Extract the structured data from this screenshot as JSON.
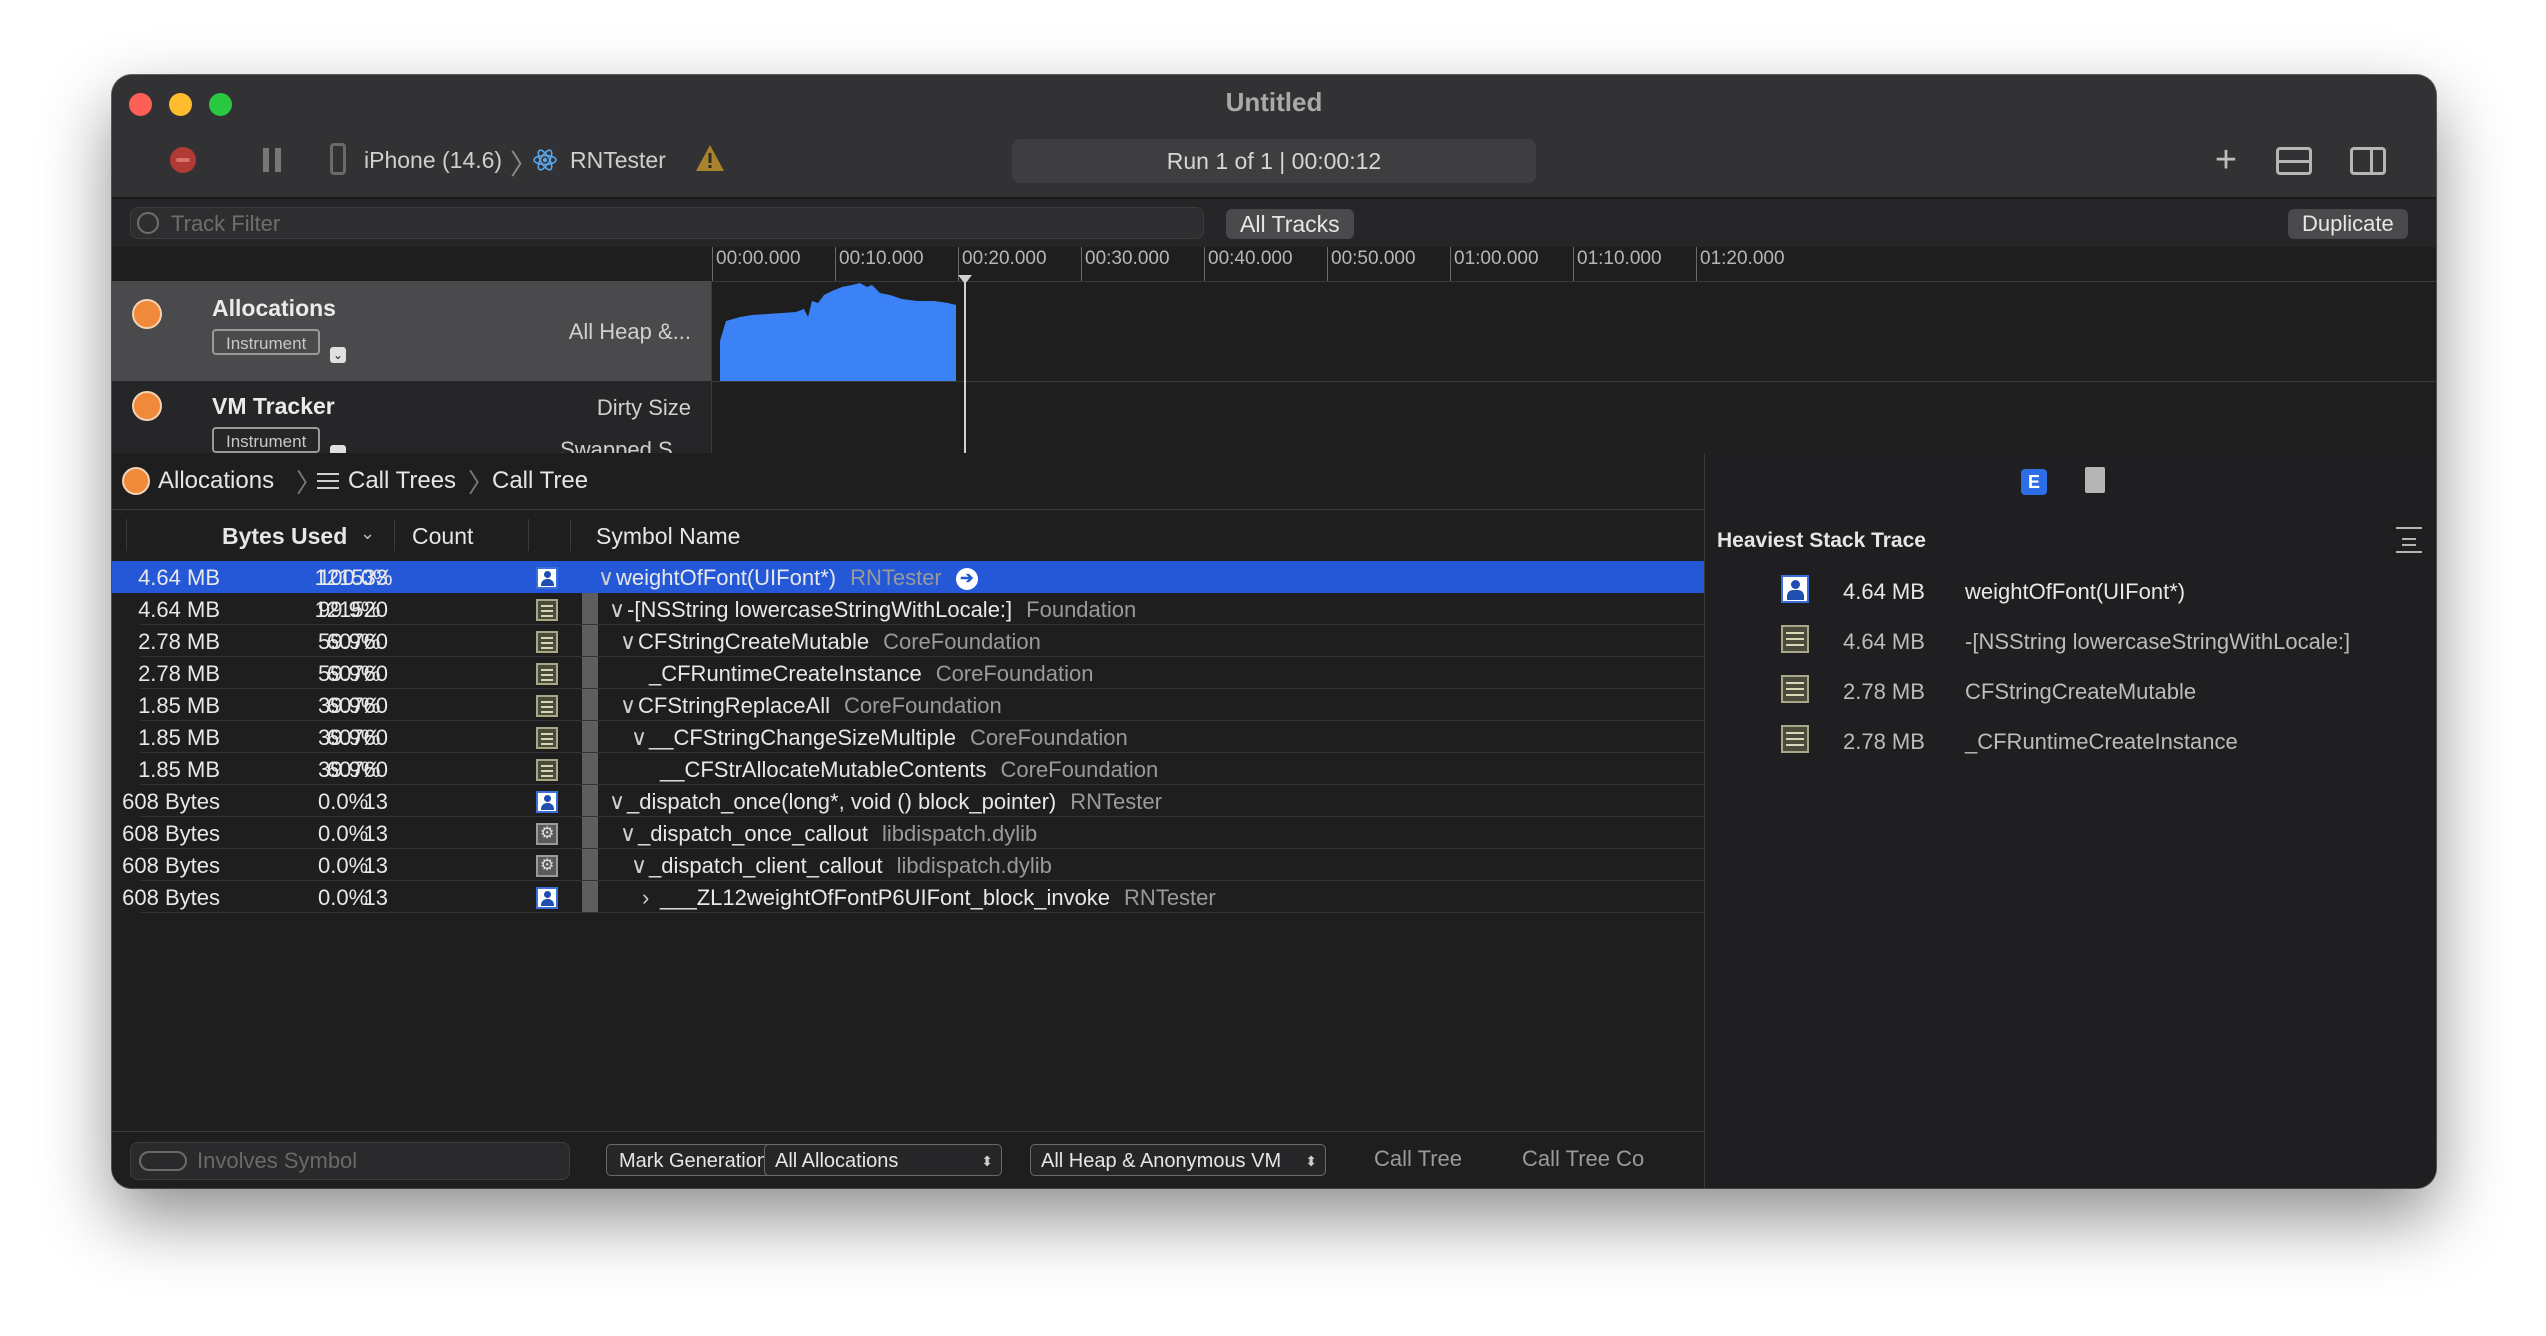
{
  "window": {
    "title": "Untitled",
    "device": "iPhone (14.6)",
    "app": "RNTester",
    "run_status": "Run 1 of 1  |  00:00:12"
  },
  "filterbar": {
    "track_filter_placeholder": "Track Filter",
    "all_tracks_label": "All Tracks",
    "duplicate_label": "Duplicate"
  },
  "timeline": {
    "ticks": [
      "00:00.000",
      "00:10.000",
      "00:20.000",
      "00:30.000",
      "00:40.000",
      "00:50.000",
      "01:00.000",
      "01:10.000",
      "01:20.000"
    ]
  },
  "tracks": [
    {
      "name": "Allocations",
      "kind": "Instrument",
      "detail": "All Heap &...",
      "selected": true
    },
    {
      "name": "VM Tracker",
      "kind": "Instrument",
      "detail": "Dirty Size",
      "detail2": "Swapped S..."
    }
  ],
  "jumpbar": {
    "instrument": "Allocations",
    "view": "Call Trees",
    "subview": "Call Tree"
  },
  "columns": {
    "bytes_used": "Bytes Used",
    "count": "Count",
    "symbol_name": "Symbol Name"
  },
  "rows": [
    {
      "bytes": "4.64 MB",
      "pct": "100.0%",
      "count": "121533",
      "icon": "user",
      "indent": 0,
      "chev": "∨",
      "symbol": "weightOfFont(UIFont*)",
      "lib": "RNTester",
      "selected": true
    },
    {
      "bytes": "4.64 MB",
      "pct": "99.9%",
      "count": "121520",
      "icon": "framework",
      "indent": 1,
      "chev": "∨",
      "symbol": "-[NSString lowercaseStringWithLocale:]",
      "lib": "Foundation"
    },
    {
      "bytes": "2.78 MB",
      "pct": "59.9%",
      "count": "60760",
      "icon": "framework",
      "indent": 2,
      "chev": "∨",
      "symbol": "CFStringCreateMutable",
      "lib": "CoreFoundation"
    },
    {
      "bytes": "2.78 MB",
      "pct": "59.9%",
      "count": "60760",
      "icon": "framework",
      "indent": 3,
      "chev": "",
      "symbol": "_CFRuntimeCreateInstance",
      "lib": "CoreFoundation"
    },
    {
      "bytes": "1.85 MB",
      "pct": "39.9%",
      "count": "60760",
      "icon": "framework",
      "indent": 2,
      "chev": "∨",
      "symbol": "CFStringReplaceAll",
      "lib": "CoreFoundation"
    },
    {
      "bytes": "1.85 MB",
      "pct": "39.9%",
      "count": "60760",
      "icon": "framework",
      "indent": 3,
      "chev": "∨",
      "symbol": "__CFStringChangeSizeMultiple",
      "lib": "CoreFoundation"
    },
    {
      "bytes": "1.85 MB",
      "pct": "39.9%",
      "count": "60760",
      "icon": "framework",
      "indent": 4,
      "chev": "",
      "symbol": "__CFStrAllocateMutableContents",
      "lib": "CoreFoundation"
    },
    {
      "bytes": "608 Bytes",
      "pct": "0.0%",
      "count": "13",
      "icon": "user",
      "indent": 1,
      "chev": "∨",
      "symbol": "_dispatch_once(long*, void () block_pointer)",
      "lib": "RNTester"
    },
    {
      "bytes": "608 Bytes",
      "pct": "0.0%",
      "count": "13",
      "icon": "gear",
      "indent": 2,
      "chev": "∨",
      "symbol": "_dispatch_once_callout",
      "lib": "libdispatch.dylib"
    },
    {
      "bytes": "608 Bytes",
      "pct": "0.0%",
      "count": "13",
      "icon": "gear",
      "indent": 3,
      "chev": "∨",
      "symbol": "_dispatch_client_callout",
      "lib": "libdispatch.dylib"
    },
    {
      "bytes": "608 Bytes",
      "pct": "0.0%",
      "count": "13",
      "icon": "user",
      "indent": 4,
      "chev": "›",
      "symbol": "___ZL12weightOfFontP6UIFont_block_invoke",
      "lib": "RNTester"
    }
  ],
  "bottombar": {
    "involves_placeholder": "Involves Symbol",
    "mark_generation": "Mark Generation",
    "allocations_select": "All Allocations",
    "heap_select": "All Heap & Anonymous VM",
    "call_tree": "Call Tree",
    "call_tree_constraints": "Call Tree Co"
  },
  "inspector": {
    "title": "Heaviest Stack Trace",
    "tab_label": "E",
    "frames": [
      {
        "size": "4.64 MB",
        "name": "weightOfFont(UIFont*)",
        "icon": "user"
      },
      {
        "size": "4.64 MB",
        "name": "-[NSString lowercaseStringWithLocale:]",
        "icon": "framework"
      },
      {
        "size": "2.78 MB",
        "name": "CFStringCreateMutable",
        "icon": "framework"
      },
      {
        "size": "2.78 MB",
        "name": "_CFRuntimeCreateInstance",
        "icon": "framework"
      }
    ]
  },
  "colors": {
    "selection": "#2458d6",
    "graph_fill": "#3b82f6",
    "instrument_orange": "#f0893a"
  }
}
